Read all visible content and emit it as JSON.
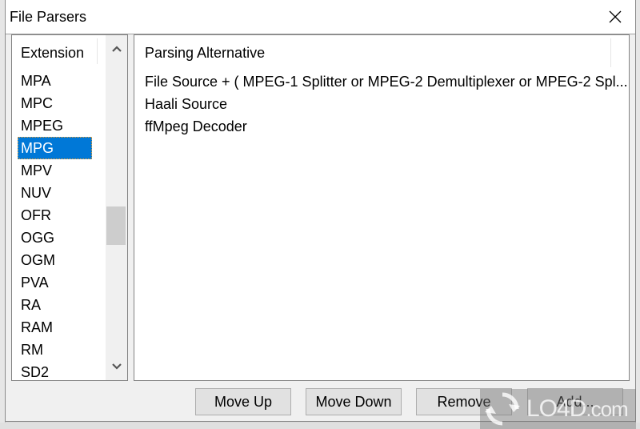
{
  "dialog": {
    "title": "File Parsers",
    "close_icon": "close-icon"
  },
  "extensions": {
    "header": "Extension",
    "items": [
      "MPA",
      "MPC",
      "MPEG",
      "MPG",
      "MPV",
      "NUV",
      "OFR",
      "OGG",
      "OGM",
      "PVA",
      "RA",
      "RAM",
      "RM",
      "SD2"
    ],
    "selected": "MPG",
    "scroll_up_icon": "chevron-up-icon",
    "scroll_down_icon": "chevron-down-icon"
  },
  "parsers": {
    "header": "Parsing Alternative",
    "items": [
      "File Source +  ( MPEG-1 Splitter or MPEG-2 Demultiplexer or MPEG-2 Spl...",
      "Haali Source",
      "ffMpeg Decoder"
    ]
  },
  "buttons": {
    "move_up": "Move Up",
    "move_down": "Move Down",
    "remove": "Remove",
    "add": "Add..."
  },
  "watermark": {
    "text_main": "LO4D",
    "text_suffix": ".com"
  },
  "colors": {
    "selection": "#0078d7",
    "dialog_bg": "#f0f0f0",
    "button_bg": "#e1e1e1"
  }
}
